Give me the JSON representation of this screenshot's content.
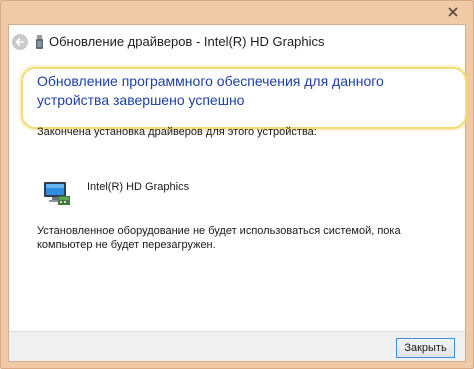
{
  "window": {
    "close_icon": "close-x-icon"
  },
  "header": {
    "back_icon": "back-arrow-icon",
    "device_icon": "usb-device-icon",
    "title": "Обновление драйверов - Intel(R) HD Graphics"
  },
  "main": {
    "instruction": "Обновление программного обеспечения для данного устройства завершено успешно",
    "installed_text": "Закончена установка драйверов для этого устройства:",
    "device": {
      "icon": "display-adapter-icon",
      "name": "Intel(R) HD Graphics"
    },
    "notice": "Установленное оборудование не будет использоваться системой, пока компьютер не будет перезагружен."
  },
  "footer": {
    "close_label": "Закрыть"
  },
  "colors": {
    "frame": "#f0c9a6",
    "instruction_text": "#1c3fa8",
    "highlight": "#f2dc7a",
    "button_focus": "#3b8fdb"
  }
}
